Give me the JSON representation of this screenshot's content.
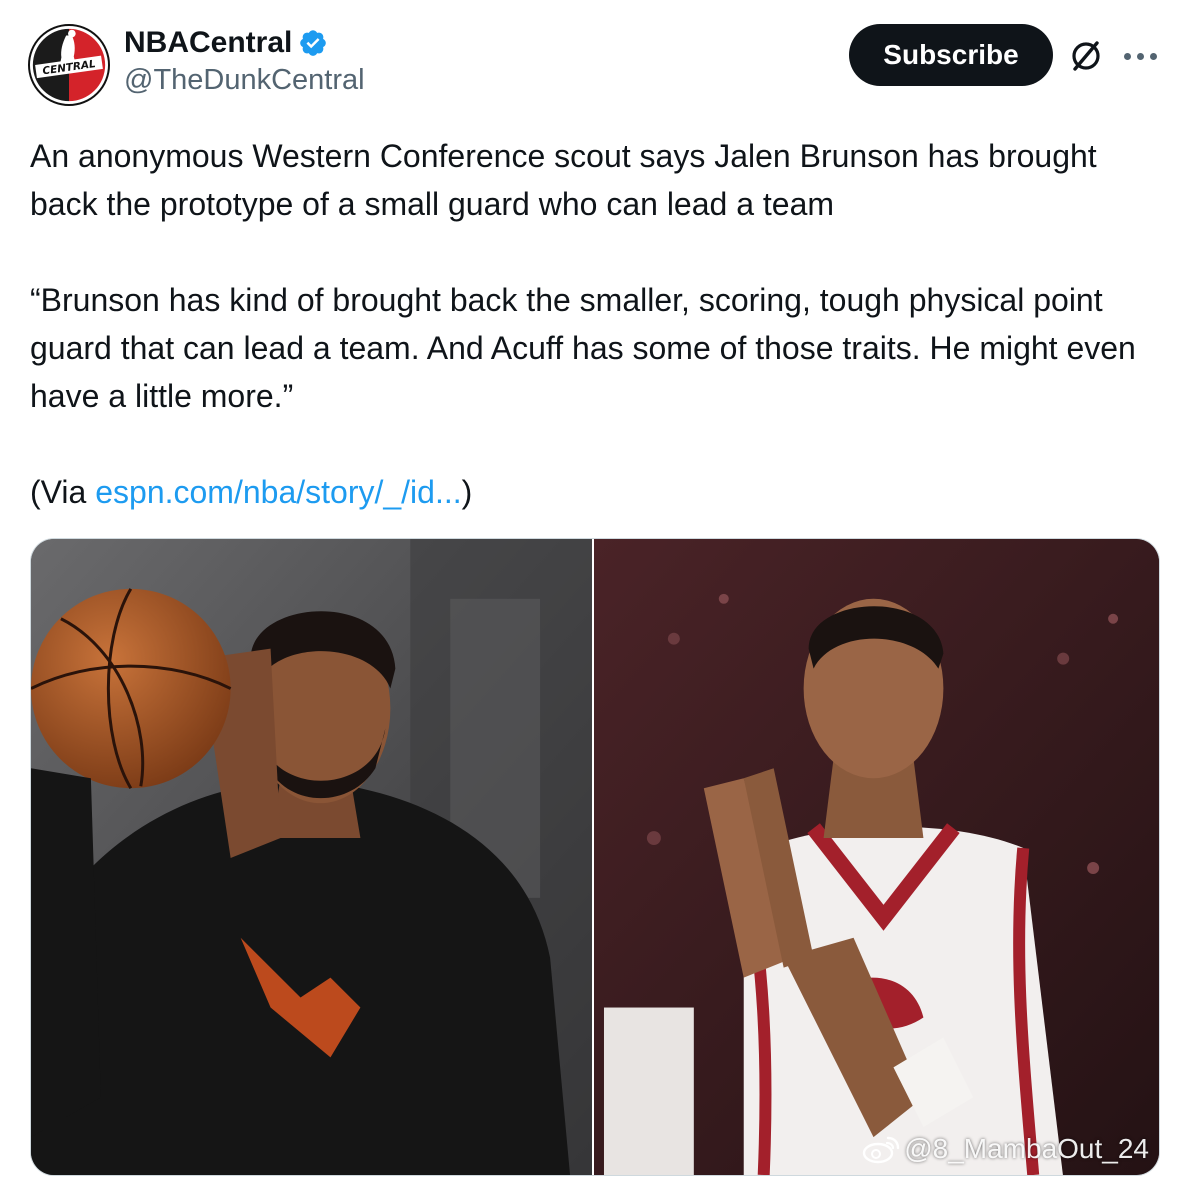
{
  "account": {
    "display_name": "NBACentral",
    "handle": "@TheDunkCentral",
    "avatar_text": "CENTRAL"
  },
  "actions": {
    "subscribe_label": "Subscribe"
  },
  "tweet": {
    "paragraph_1": "An anonymous Western Conference scout says Jalen Brunson has brought back the prototype of a small guard who can lead a team",
    "paragraph_2": "“Brunson has kind of brought back the smaller, scoring, tough physical point guard that can lead a team. And Acuff has some of those traits. He might even have a little more.”",
    "via_prefix": "(Via ",
    "via_link": "espn.com/nba/story/_/id...",
    "via_suffix": ")"
  },
  "media": {
    "watermark": "@8_MambaOut_24"
  },
  "colors": {
    "link": "#1d9bf0",
    "subscribe_bg": "#0f1419",
    "secondary_text": "#536471",
    "verified": "#1d9bf0"
  },
  "icons": [
    "verified-badge-icon",
    "grok-icon",
    "more-icon",
    "weibo-icon"
  ]
}
